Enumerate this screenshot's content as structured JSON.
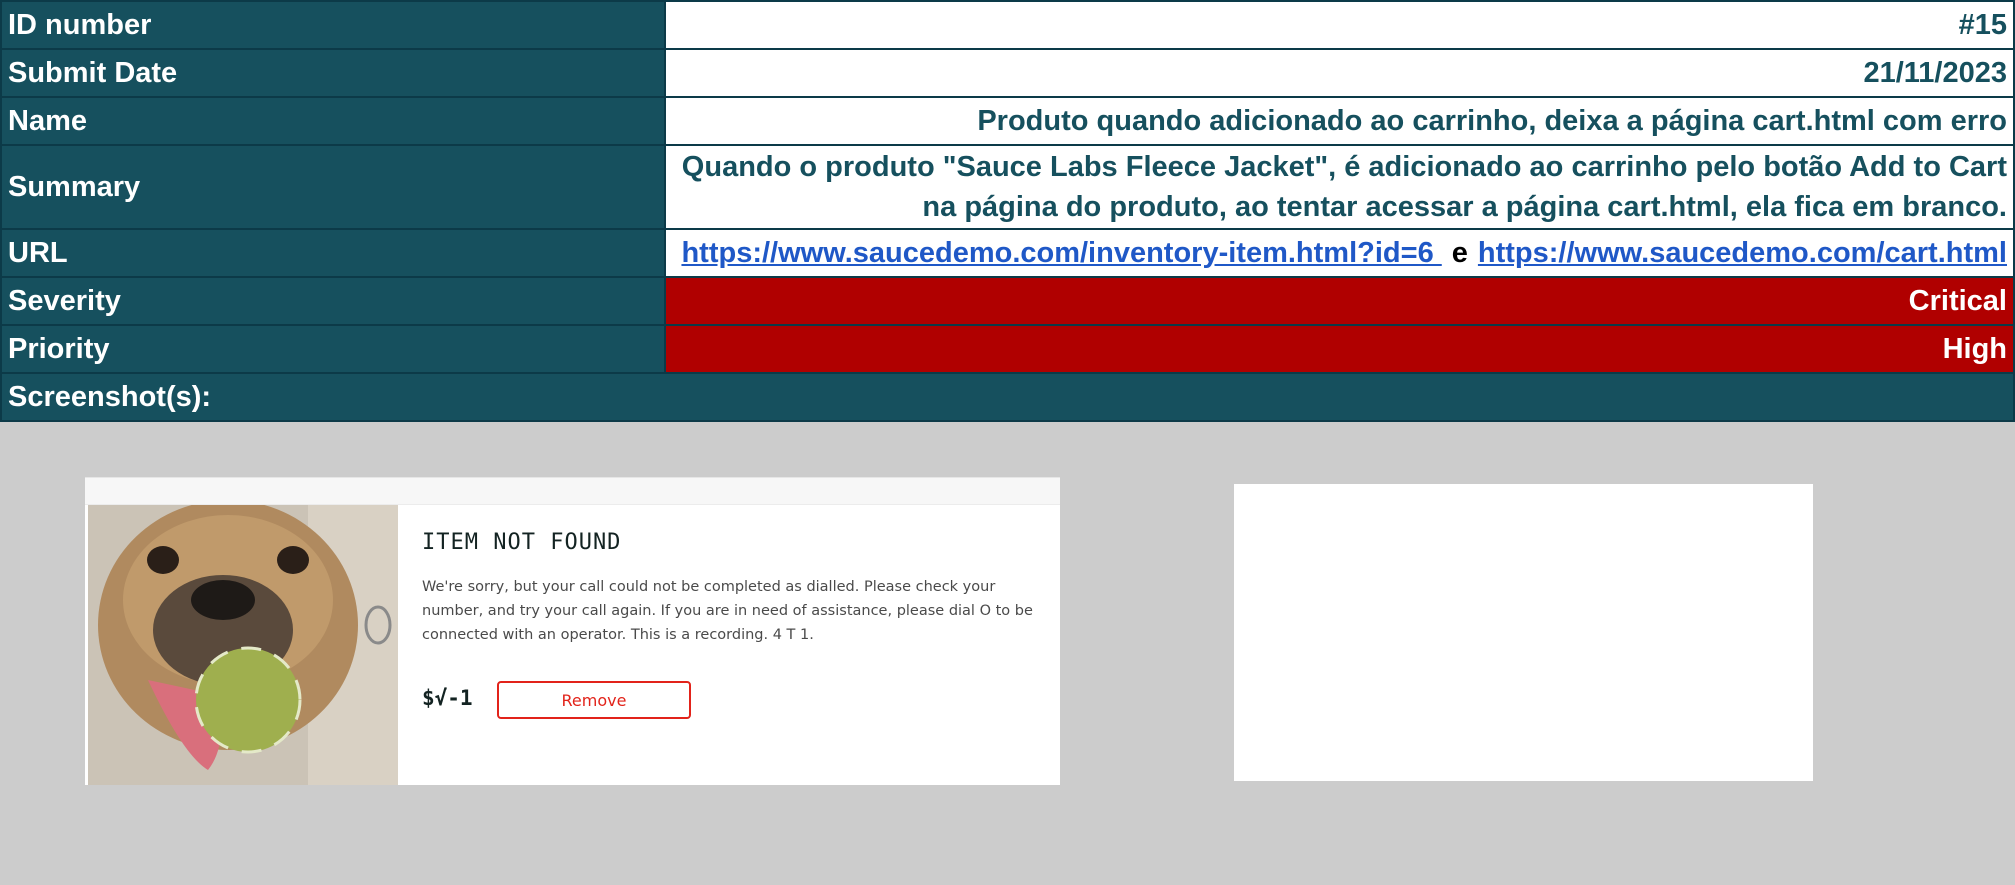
{
  "rows": {
    "id": {
      "label": "ID number",
      "value": "#15"
    },
    "date": {
      "label": "Submit Date",
      "value": "21/11/2023"
    },
    "name": {
      "label": "Name",
      "value": "Produto quando adicionado ao carrinho, deixa a página cart.html com erro"
    },
    "summary": {
      "label": "Summary",
      "line1": "Quando o  produto  \"Sauce Labs Fleece Jacket\", é adicionado ao carrinho pelo botão  Add to Cart",
      "line2": "na página do produto, ao tentar acessar a página cart.html, ela fica em branco."
    },
    "url": {
      "label": "URL",
      "link1": "https://www.saucedemo.com/inventory-item.html?id=6 ",
      "separator": "e",
      "link2": "https://www.saucedemo.com/cart.html"
    },
    "severity": {
      "label": "Severity",
      "value": "Critical"
    },
    "priority": {
      "label": "Priority",
      "value": "High"
    },
    "screenshots": {
      "label": "Screenshot(s):"
    }
  },
  "screenshot1": {
    "title": "ITEM NOT FOUND",
    "description": "We're sorry, but your call could not be completed as dialled. Please check your number, and try your call again. If you are in need of assistance, please dial O to be connected with an operator. This is a recording. 4 T 1.",
    "price": "$√-1",
    "remove_label": "Remove"
  },
  "colors": {
    "header": "#16505e",
    "critical": "#b00000",
    "link": "#1f58c7",
    "background": "#cccccc"
  }
}
